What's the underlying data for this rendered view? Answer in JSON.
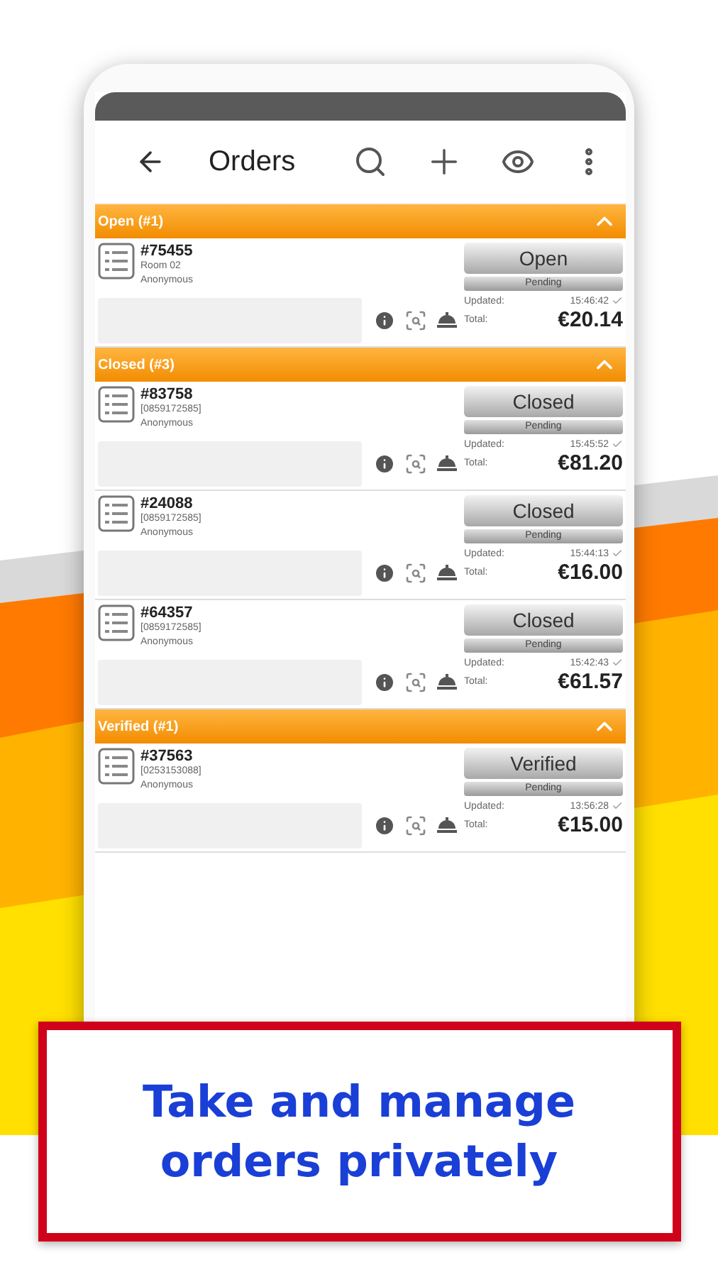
{
  "app_bar": {
    "title": "Orders"
  },
  "sections": [
    {
      "title": "Open (#1)",
      "expanded": true,
      "orders": [
        {
          "number": "#75455",
          "detail": "Room 02",
          "customer": "Anonymous",
          "status": "Open",
          "payment": "Pending",
          "updated_label": "Updated:",
          "updated": "15:46:42",
          "synced": true,
          "total_label": "Total:",
          "total": "€20.14"
        }
      ]
    },
    {
      "title": "Closed (#3)",
      "expanded": true,
      "orders": [
        {
          "number": "#83758",
          "detail": "[0859172585]",
          "customer": "Anonymous",
          "status": "Closed",
          "payment": "Pending",
          "updated_label": "Updated:",
          "updated": "15:45:52",
          "synced": true,
          "total_label": "Total:",
          "total": "€81.20"
        },
        {
          "number": "#24088",
          "detail": "[0859172585]",
          "customer": "Anonymous",
          "status": "Closed",
          "payment": "Pending",
          "updated_label": "Updated:",
          "updated": "15:44:13",
          "synced": true,
          "total_label": "Total:",
          "total": "€16.00"
        },
        {
          "number": "#64357",
          "detail": "[0859172585]",
          "customer": "Anonymous",
          "status": "Closed",
          "payment": "Pending",
          "updated_label": "Updated:",
          "updated": "15:42:43",
          "synced": true,
          "total_label": "Total:",
          "total": "€61.57"
        }
      ]
    },
    {
      "title": "Verified (#1)",
      "expanded": true,
      "orders": [
        {
          "number": "#37563",
          "detail": "[0253153088]",
          "customer": "Anonymous",
          "status": "Verified",
          "payment": "Pending",
          "updated_label": "Updated:",
          "updated": "13:56:28",
          "synced": true,
          "total_label": "Total:",
          "total": "€15.00"
        }
      ]
    }
  ],
  "caption": "Take and manage orders privately"
}
